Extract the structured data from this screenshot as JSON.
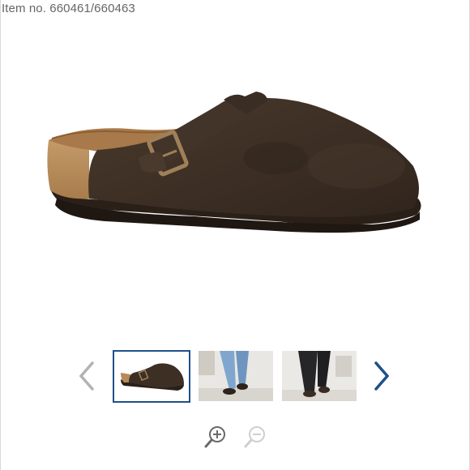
{
  "product": {
    "item_number": "Item no. 660461/660463"
  },
  "main_image": {
    "subject": "brown suede clog with buckle strap and cork footbed",
    "colors": {
      "suede": "#3d2f24",
      "cork": "#b88a57",
      "footbed": "#a8794a",
      "sole": "#2a2018",
      "buckle": "#a08058"
    }
  },
  "gallery": {
    "selected_index": 0,
    "thumbnails": [
      {
        "subject": "clog product photo"
      },
      {
        "subject": "model wearing light jeans and clogs"
      },
      {
        "subject": "model wearing dark trousers and clogs"
      }
    ],
    "prev_icon": "chevron-left-icon",
    "next_icon": "chevron-right-icon",
    "colors": {
      "selected_border": "#1f4f8b",
      "next_arrow": "#1f4f8b",
      "prev_arrow": "#b3b3b3"
    }
  },
  "zoom": {
    "zoom_in_icon": "zoom-in-icon",
    "zoom_out_icon": "zoom-out-icon",
    "zoom_in_enabled": true,
    "zoom_out_enabled": false
  }
}
